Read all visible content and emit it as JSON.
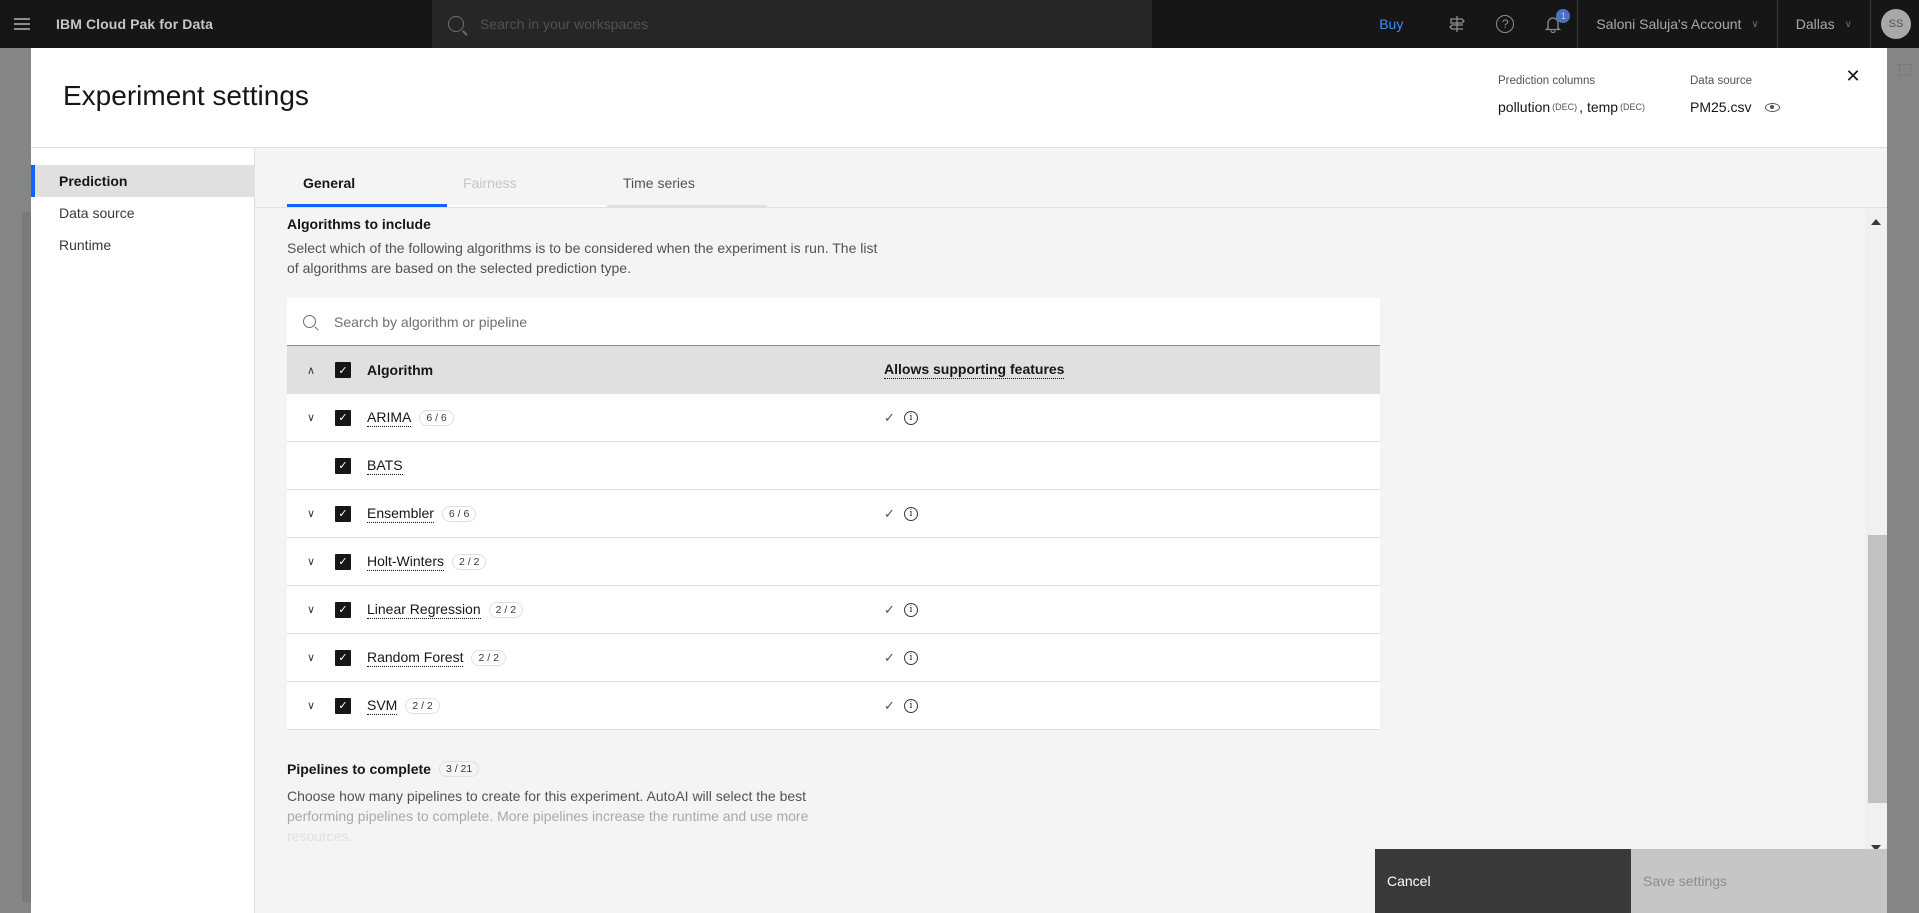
{
  "topbar": {
    "brand": "IBM Cloud Pak for Data",
    "search_placeholder": "Search in your workspaces",
    "buy_label": "Buy",
    "notification_count": "1",
    "account_label": "Saloni Saluja's Account",
    "region_label": "Dallas",
    "avatar_initials": "SS"
  },
  "modal": {
    "title": "Experiment settings",
    "prediction_columns_label": "Prediction columns",
    "prediction_columns": [
      {
        "name": "pollution",
        "type": "(DEC)"
      },
      {
        "name": "temp",
        "type": "(DEC)"
      }
    ],
    "data_source_label": "Data source",
    "data_source_value": "PM25.csv"
  },
  "side_nav": {
    "items": [
      {
        "label": "Prediction",
        "active": true
      },
      {
        "label": "Data source",
        "active": false
      },
      {
        "label": "Runtime",
        "active": false
      }
    ]
  },
  "tabs": [
    {
      "label": "General",
      "state": "active"
    },
    {
      "label": "Fairness",
      "state": "disabled"
    },
    {
      "label": "Time series",
      "state": "normal"
    }
  ],
  "algorithms_section": {
    "title": "Algorithms to include",
    "description": "Select which of the following algorithms is to be considered when the experiment is run. The list of algorithms are based on the selected prediction type.",
    "search_placeholder": "Search by algorithm or pipeline",
    "header": {
      "algorithm": "Algorithm",
      "supporting_features": "Allows supporting features"
    },
    "rows": [
      {
        "name": "ARIMA",
        "count": "6 / 6",
        "expandable": true,
        "checked": true,
        "supporting": true
      },
      {
        "name": "BATS",
        "count": "",
        "expandable": false,
        "checked": true,
        "supporting": false
      },
      {
        "name": "Ensembler",
        "count": "6 / 6",
        "expandable": true,
        "checked": true,
        "supporting": true
      },
      {
        "name": "Holt-Winters",
        "count": "2 / 2",
        "expandable": true,
        "checked": true,
        "supporting": false
      },
      {
        "name": "Linear Regression",
        "count": "2 / 2",
        "expandable": true,
        "checked": true,
        "supporting": true
      },
      {
        "name": "Random Forest",
        "count": "2 / 2",
        "expandable": true,
        "checked": true,
        "supporting": true
      },
      {
        "name": "SVM",
        "count": "2 / 2",
        "expandable": true,
        "checked": true,
        "supporting": true
      }
    ]
  },
  "pipelines_section": {
    "title": "Pipelines to complete",
    "count": "3 / 21",
    "description_line1": "Choose how many pipelines to create for this experiment. AutoAI will select the best",
    "description_line2": "performing pipelines to complete. More pipelines increase the runtime and use more",
    "description_line3": "resources."
  },
  "footer": {
    "cancel_label": "Cancel",
    "save_label": "Save settings"
  },
  "icons": {
    "check": "✓",
    "chevron_down": "⌄",
    "chevron_up": "⌃",
    "close": "✕",
    "info": "i"
  }
}
